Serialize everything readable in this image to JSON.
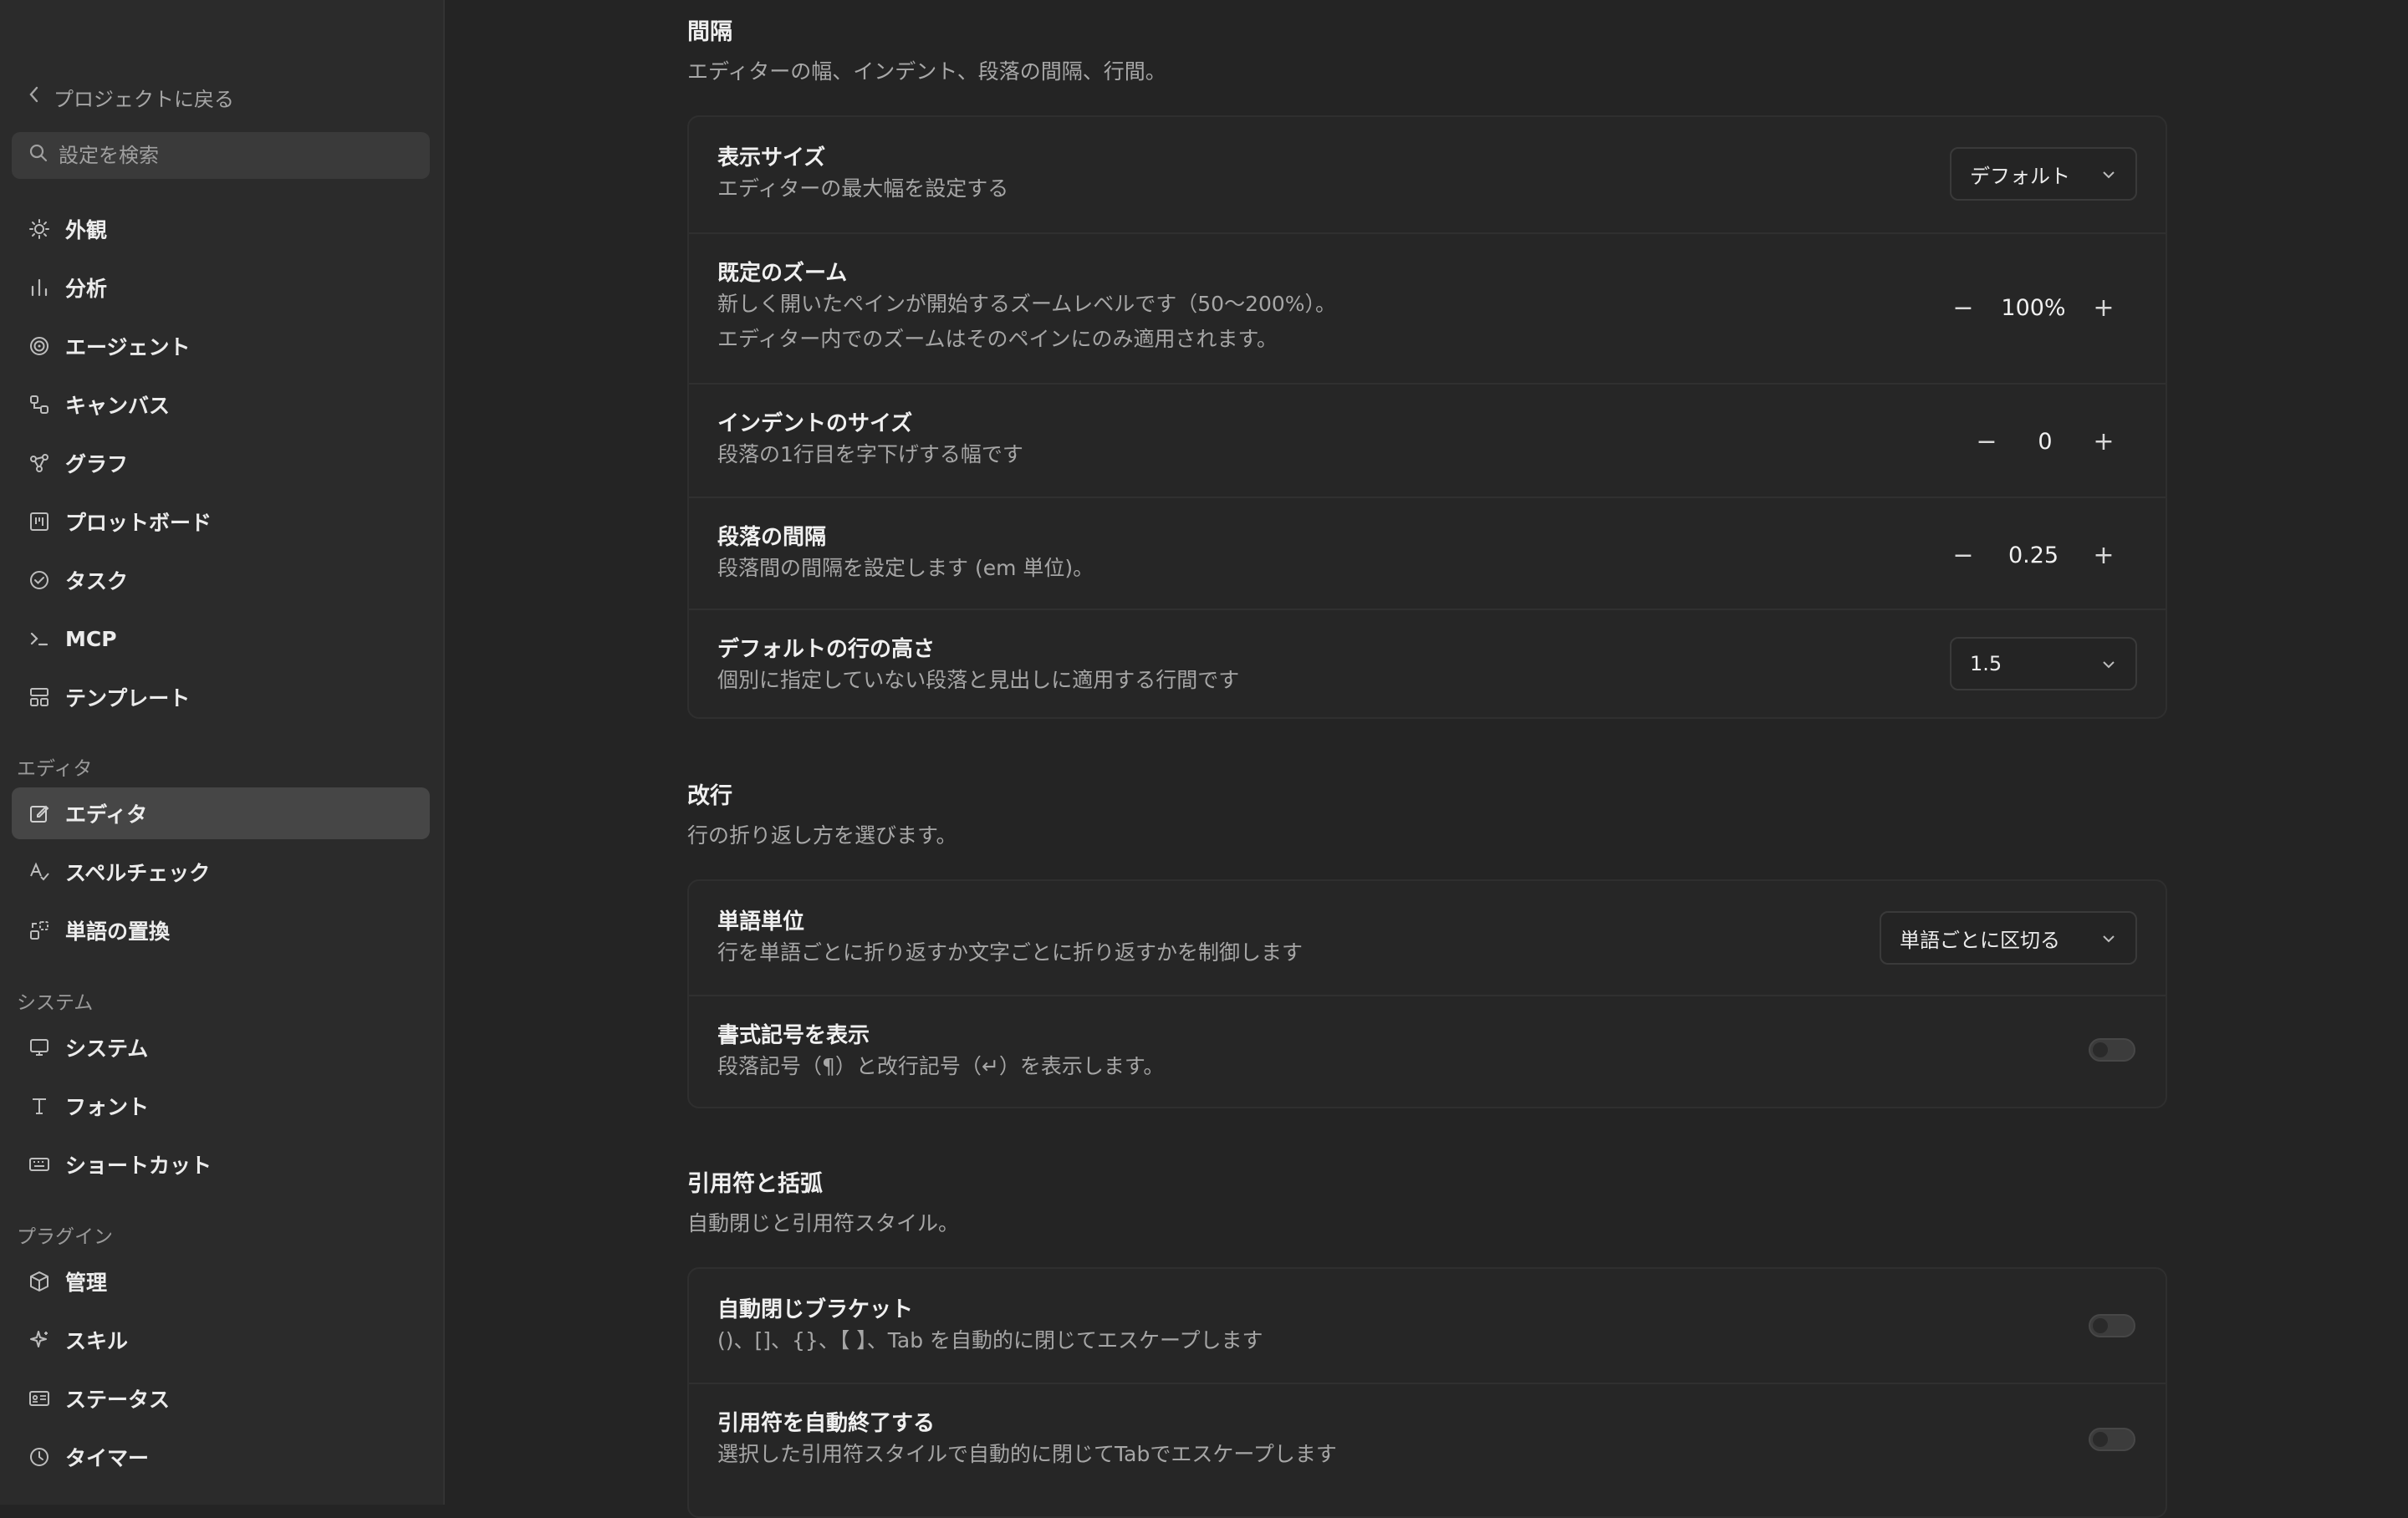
{
  "sidebar": {
    "back_label": "プロジェクトに戻る",
    "search_placeholder": "設定を検索",
    "items_top": [
      {
        "label": "外観",
        "icon": "sun-icon"
      },
      {
        "label": "分析",
        "icon": "bar-chart-icon"
      },
      {
        "label": "エージェント",
        "icon": "spiral-icon"
      },
      {
        "label": "キャンバス",
        "icon": "canvas-icon"
      },
      {
        "label": "グラフ",
        "icon": "graph-icon"
      },
      {
        "label": "プロットボード",
        "icon": "board-icon"
      },
      {
        "label": "タスク",
        "icon": "check-circle-icon"
      },
      {
        "label": "MCP",
        "icon": "terminal-icon"
      },
      {
        "label": "テンプレート",
        "icon": "template-icon"
      }
    ],
    "editor_section": "エディタ",
    "items_editor": [
      {
        "label": "エディタ",
        "icon": "edit-icon",
        "active": true
      },
      {
        "label": "スペルチェック",
        "icon": "spellcheck-icon"
      },
      {
        "label": "単語の置換",
        "icon": "replace-icon"
      }
    ],
    "system_section": "システム",
    "items_system": [
      {
        "label": "システム",
        "icon": "monitor-icon"
      },
      {
        "label": "フォント",
        "icon": "font-icon"
      },
      {
        "label": "ショートカット",
        "icon": "keyboard-icon"
      }
    ],
    "plugins_section": "プラグイン",
    "items_plugins": [
      {
        "label": "管理",
        "icon": "cube-icon"
      },
      {
        "label": "スキル",
        "icon": "sparkle-icon"
      },
      {
        "label": "ステータス",
        "icon": "id-card-icon"
      },
      {
        "label": "タイマー",
        "icon": "clock-icon"
      }
    ]
  },
  "spacing": {
    "title": "間隔",
    "desc": "エディターの幅、インデント、段落の間隔、行間。",
    "display_size": {
      "title": "表示サイズ",
      "desc": "エディターの最大幅を設定する",
      "value": "デフォルト"
    },
    "zoom": {
      "title": "既定のズーム",
      "desc1": "新しく開いたペインが開始するズームレベルです（50〜200%）。",
      "desc2": "エディター内でのズームはそのペインにのみ適用されます。",
      "value": "100%"
    },
    "indent": {
      "title": "インデントのサイズ",
      "desc": "段落の1行目を字下げする幅です",
      "value": "0"
    },
    "paragraph": {
      "title": "段落の間隔",
      "desc": "段落間の間隔を設定します (em 単位)。",
      "value": "0.25"
    },
    "line_height": {
      "title": "デフォルトの行の高さ",
      "desc": "個別に指定していない段落と見出しに適用する行間です",
      "value": "1.5"
    }
  },
  "wrap": {
    "title": "改行",
    "desc": "行の折り返し方を選びます。",
    "word_unit": {
      "title": "単語単位",
      "desc": "行を単語ごとに折り返すか文字ごとに折り返すかを制御します",
      "value": "単語ごとに区切る"
    },
    "format_marks": {
      "title": "書式記号を表示",
      "desc": "段落記号（¶）と改行記号（↵）を表示します。",
      "enabled": false
    }
  },
  "quotes": {
    "title": "引用符と括弧",
    "desc": "自動閉じと引用符スタイル。",
    "auto_bracket": {
      "title": "自動閉じブラケット",
      "desc": "()、[]、{}、【 】、Tab を自動的に閉じてエスケープします",
      "enabled": false
    },
    "auto_quote": {
      "title": "引用符を自動終了する",
      "desc": "選択した引用符スタイルで自動的に閉じてTabでエスケープします",
      "enabled": false
    }
  },
  "stepper_minus": "−",
  "stepper_plus": "+"
}
